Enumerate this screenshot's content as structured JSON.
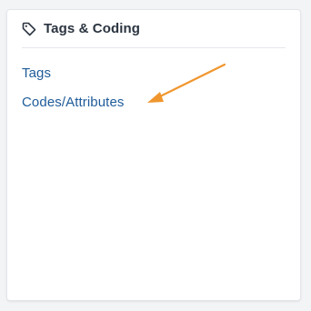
{
  "card": {
    "title": "Tags & Coding",
    "icon": "tag-icon"
  },
  "links": [
    {
      "label": "Tags"
    },
    {
      "label": "Codes/Attributes"
    }
  ],
  "colors": {
    "title": "#2b3440",
    "link": "#1f5c99",
    "annotation_arrow": "#f0962e"
  }
}
